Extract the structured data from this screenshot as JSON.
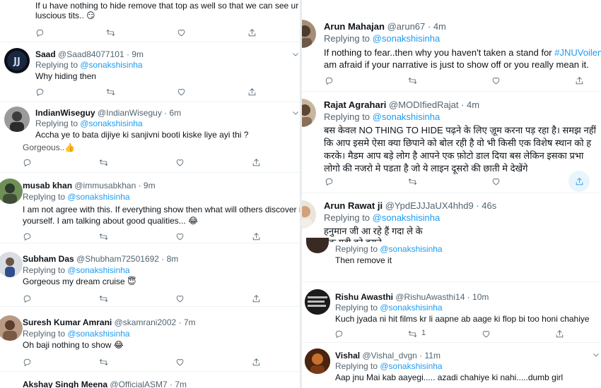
{
  "left": {
    "tweet0": {
      "text": "If u have nothing to hide remove that top as well so that we can see ur",
      "text2": "luscious tits.. 😏"
    },
    "tweet1": {
      "name": "Saad",
      "handle": "@Saad84077101 · 9m",
      "replying": "Replying to ",
      "mention": "@sonakshisinha",
      "text": "Why hiding then"
    },
    "tweet2": {
      "name": "IndianWiseguy",
      "handle": "@IndianWiseguy · 6m",
      "replying": "Replying to ",
      "mention": "@sonakshisinha",
      "text": "Accha ye to bata dijiye ki sanjivni booti kiske liye ayi thi ?",
      "overlay": "Gorgeous..👍"
    },
    "tweet3": {
      "name": "musab khan",
      "handle": "@immusabkhan · 9m",
      "replying": "Replying to ",
      "mention": "@sonakshisinha",
      "text": "I am not agree with this. If everything show then what will others discover i",
      "text2": "yourself. I am talking about good qualities... 😂"
    },
    "tweet4": {
      "name": "Subham Das",
      "handle": "@Shubham72501692 · 8m",
      "replying": "Replying to ",
      "mention": "@sonakshisinha",
      "text": "Gorgeous my dream cruise 😇"
    },
    "tweet5": {
      "name": "Suresh Kumar Amrani",
      "handle": "@skamrani2002 · 7m",
      "replying": "Replying to ",
      "mention": "@sonakshisinha",
      "text": "Oh baji nothing to show 😂"
    },
    "tweet6": {
      "name": "Akshay Singh Meena",
      "handle": "@OfficialASM7 · 7m"
    }
  },
  "right": {
    "tweet1": {
      "name": "Arun Mahajan",
      "handle": "@arun67 · 4m",
      "replying": "Replying to ",
      "mention": "@sonakshisinha",
      "text_pre": "If nothing to fear..then why you haven't taken a stand for ",
      "hashtag": "#JNUVoilen",
      "text2": "am afraid if your narrative is just to show off or you really mean it."
    },
    "tweet2": {
      "name": "Rajat Agrahari",
      "handle": "@MODIfiedRajat · 4m",
      "replying": "Replying to ",
      "mention": "@sonakshisinha",
      "line1": "बस केवल NO THING TO HIDE पढ़ने के लिए ज़ूम करना पड़ रहा है। समझ नहीं",
      "line2": "कि आप इसमे ऐसा क्या छिपाने को बोल रही है वो भी किसी एक विशेष स्थान को ह",
      "line3": "करके। मैडम आप बड़े लोग है आपने एक फ़ोटो डाल दिया बस लेकिन इसका प्रभा",
      "line4": "लोगो की नजरो मे पडता है जो ये लाइन दूसरो की छाती मे देखेंगे"
    },
    "tweet3": {
      "name": "Arun Rawat ji",
      "handle": "@YpdEJJJaUX4hhd9 · 46s",
      "replying": "Replying to ",
      "mention": "@sonakshisinha",
      "line1": "हनुमान जी आ रहे हैं गदा ले के",
      "line2": "एक गदी को हराने",
      "sub_replying": "Replying to ",
      "sub_mention": "@sonakshisinha",
      "sub_text": "Then remove it"
    },
    "tweet4": {
      "name": "Rishu Awasthi",
      "handle": "@RishuAwasthi14 · 10m",
      "replying": "Replying to ",
      "mention": "@sonakshisinha",
      "text": "Kuch jyada ni hit films kr li aapne ab aage ki flop bi too honi chahiye",
      "retweet_count": "1"
    },
    "tweet5": {
      "name": "Vishal",
      "handle": "@Vishal_dvgn · 11m",
      "replying": "Replying to ",
      "mention": "@sonakshisinha",
      "text": "Aap jnu Mai kab aayegi..... azadi chahiye ki nahi.....dumb girl"
    }
  },
  "icons": {
    "reply": "reply-icon",
    "retweet": "retweet-icon",
    "like": "like-icon",
    "share": "share-icon",
    "caret": "chevron-down-icon"
  },
  "colors": {
    "accent": "#1d9bf0",
    "muted": "#536471",
    "border": "#eff3f4",
    "text": "#0f1419"
  }
}
